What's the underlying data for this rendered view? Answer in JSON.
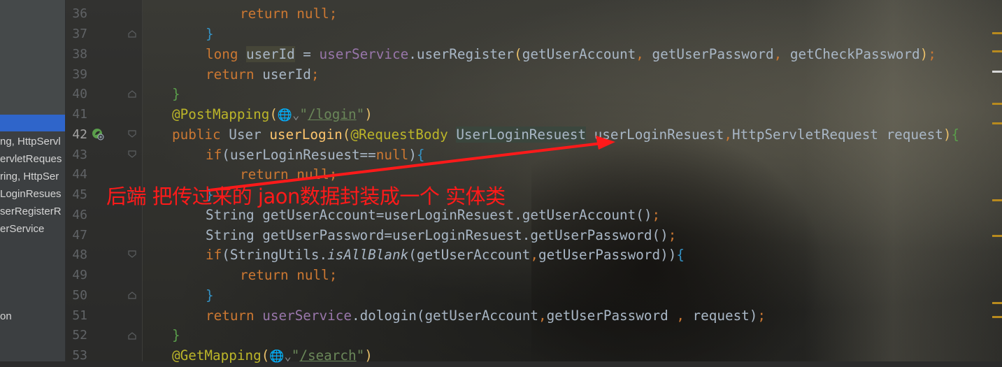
{
  "project_panel": {
    "items": [
      {
        "label": "ng, HttpServl",
        "selected": false
      },
      {
        "label": "ervletReques",
        "selected": false
      },
      {
        "label": "ring, HttpSer",
        "selected": false
      },
      {
        "label": "LoginResues",
        "selected": false
      },
      {
        "label": "serRegisterR",
        "selected": false
      },
      {
        "label": "erService",
        "selected": false
      },
      {
        "label": "on",
        "selected": false
      }
    ]
  },
  "editor": {
    "current_line": "42",
    "line_numbers": [
      "36",
      "37",
      "38",
      "39",
      "40",
      "41",
      "42",
      "43",
      "44",
      "45",
      "46",
      "47",
      "48",
      "49",
      "50",
      "51",
      "52",
      "53"
    ],
    "code": {
      "l36": {
        "ret": "return",
        "null": "null",
        "semi": ";"
      },
      "l37": {
        "brace": "}"
      },
      "l38": {
        "type": "long",
        "var": "userId",
        "eq": " = ",
        "svc": "userService",
        "dot": ".",
        "method": "userRegister",
        "open": "(",
        "a1": "getUserAccount",
        "comma1": ", ",
        "a2": "getUserPassword",
        "comma2": ", ",
        "a3": "getCheckPassword",
        "close": ")",
        "semi": ";"
      },
      "l39": {
        "ret": "return",
        "rest": " userId",
        "semi": ";"
      },
      "l40": {
        "brace": "}"
      },
      "l41": {
        "ann": "@PostMapping",
        "open": "(",
        "globe": "🌐",
        "chev": "⌄",
        "q1": "\"",
        "url": "/login",
        "q2": "\"",
        "close": ")"
      },
      "l42": {
        "pub": "public",
        "type": " User ",
        "method": "userLogin",
        "open": "(",
        "ann": "@RequestBody",
        "sp": " ",
        "ptype": "UserLoginResuest",
        "pname": " userLoginResuest",
        "comma": ",",
        "rest": "HttpServletRequest request",
        "close": ")",
        "brace": "{"
      },
      "l43": {
        "kw": "if",
        "cond": "(userLoginResuest==",
        "null": "null",
        "close": ")",
        "brace": "{"
      },
      "l44": {
        "ret": "return",
        "null": "null",
        "semi": ";"
      },
      "l45": {
        "brace": "}"
      },
      "l46": {
        "text": "String getUserAccount=userLoginResuest.getUserAccount()",
        "semi": ";"
      },
      "l47": {
        "text": "String getUserPassword=userLoginResuest.getUserPassword()",
        "semi": ";"
      },
      "l48": {
        "kw": "if",
        "pre": "(StringUtils.",
        "method": "isAllBlank",
        "args": "(getUserAccount",
        "comma": ",",
        "args2": "getUserPassword))",
        "brace": "{"
      },
      "l49": {
        "ret": "return",
        "null": "null",
        "semi": ";"
      },
      "l50": {
        "brace": "}"
      },
      "l51": {
        "ret": "return",
        "svc": "userService",
        "call": ".dologin(getUserAccount",
        "comma1": ",",
        "a2": "getUserPassword ",
        "comma2": ",",
        "a3": " request)",
        "semi": ";"
      },
      "l52": {
        "brace": "}"
      },
      "l53": {
        "ann": "@GetMapping",
        "open": "(",
        "globe": "🌐",
        "chev": "⌄",
        "q1": "\"",
        "url": "/search",
        "q2": "\"",
        "close": ")"
      }
    }
  },
  "annotation": {
    "text": "后端 把传过来的 jaon数据封装成一个 实体类",
    "color": "#ff1a1a"
  },
  "icons": {
    "run_gutter": "spring-bean-run-icon",
    "fold": "fold-marker-icon"
  }
}
